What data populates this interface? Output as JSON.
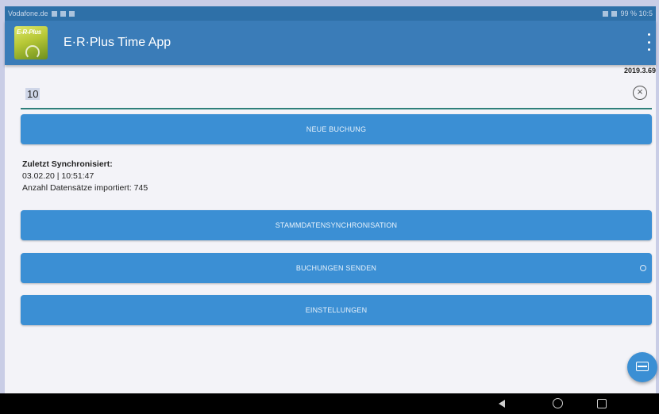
{
  "status_bar": {
    "left_text": "Vodafone.de",
    "right_text": "99 % 10:5"
  },
  "app_bar": {
    "logo_text": "E-R-Plus",
    "title": "E·R·Plus Time App"
  },
  "version": "2019.3.69",
  "input": {
    "value": "10"
  },
  "buttons": {
    "neue_buchung": "NEUE BUCHUNG",
    "stammdaten": "STAMMDATENSYNCHRONISATION",
    "buchungen_senden": "BUCHUNGEN SENDEN",
    "einstellungen": "EINSTELLUNGEN"
  },
  "sync": {
    "title": "Zuletzt Synchronisiert:",
    "timestamp": "03.02.20 | 10:51:47",
    "records": "Anzahl Datensätze importiert: 745"
  },
  "colors": {
    "app_bar": "#3a7cb8",
    "button": "#3b8fd4",
    "input_underline": "#2e7f7a"
  },
  "icons": {
    "clear": "clear-circle-icon",
    "overflow": "overflow-menu-icon",
    "fab": "fab-keyboard-icon",
    "nav_back": "nav-back-icon",
    "nav_home": "nav-home-icon",
    "nav_recent": "nav-recent-icon"
  }
}
